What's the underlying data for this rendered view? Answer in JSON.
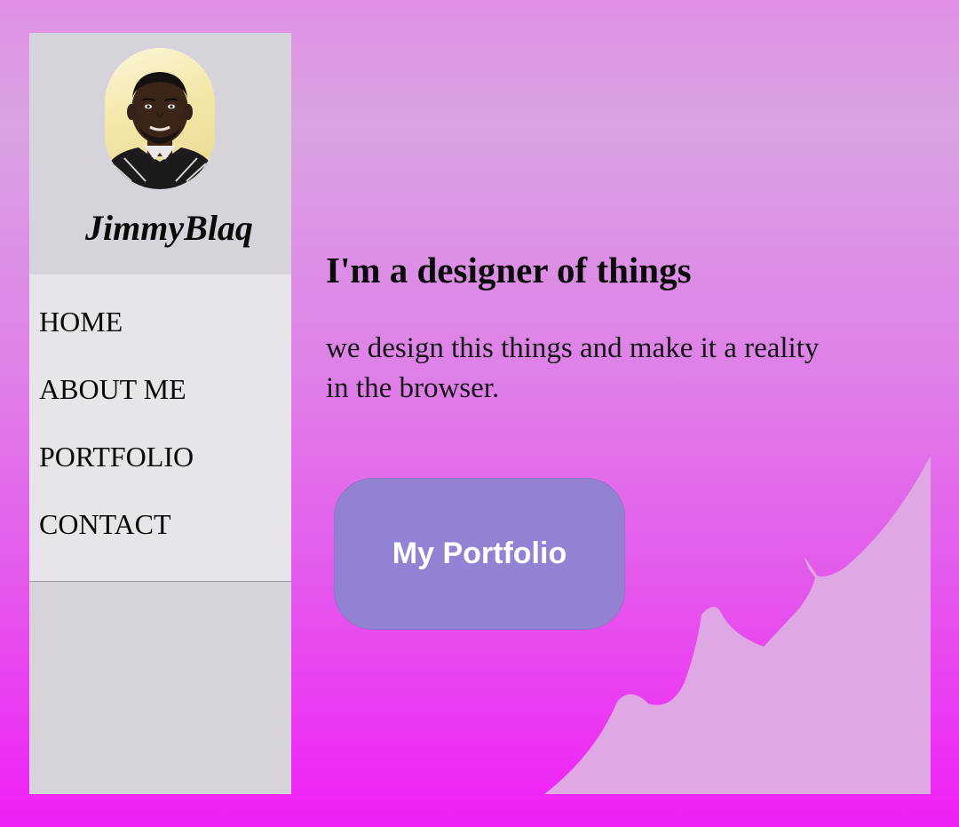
{
  "profile": {
    "name": "JimmyBlaq",
    "avatar_icon": "person-portrait"
  },
  "nav": {
    "items": [
      {
        "label": "HOME"
      },
      {
        "label": "ABOUT ME"
      },
      {
        "label": "PORTFOLIO"
      },
      {
        "label": "CONTACT"
      }
    ]
  },
  "hero": {
    "title": "I'm a designer of things",
    "text": "we design this things and make it a reality in the browser.",
    "button_label": "My Portfolio"
  },
  "colors": {
    "sidebar": "#d6d4da",
    "nav_bg": "#e7e5e9",
    "button": "#9381d4",
    "decoration": "#dfa7e3",
    "background_top": "#df90e4",
    "background_bottom": "#f01ff7"
  }
}
